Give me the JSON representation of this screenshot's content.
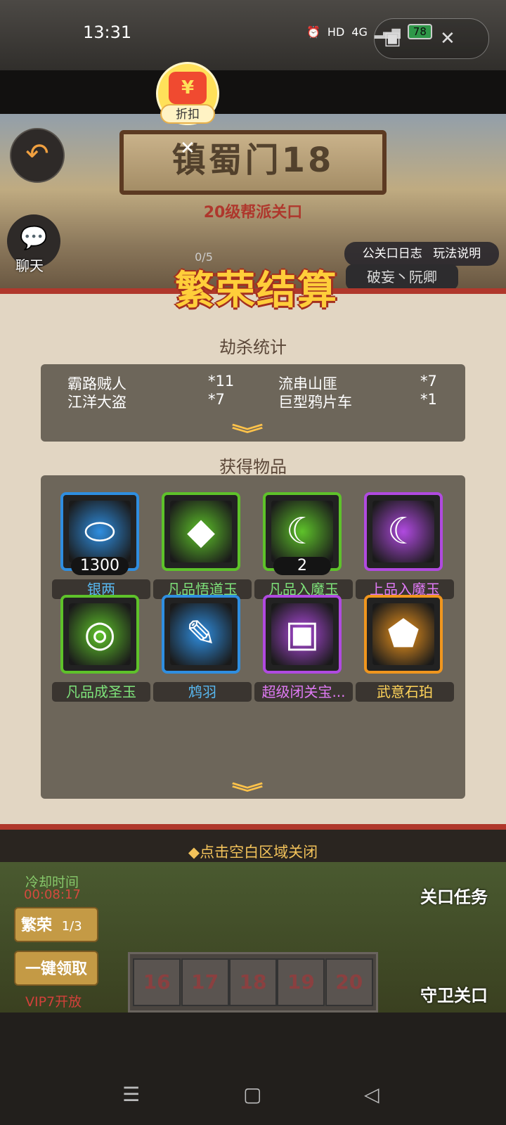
{
  "status_bar": {
    "time": "13:31",
    "battery": "78",
    "network": "4G",
    "hd": "HD"
  },
  "discount": {
    "label": "折扣"
  },
  "stage": {
    "title": "镇蜀门18",
    "subtitle": "20级帮派关口",
    "progress": "0/5"
  },
  "overlay_left": {
    "chat_label": "聊天"
  },
  "overlay_right": {
    "log_label": "公关口日志",
    "help_label": "玩法说明",
    "player_name": "破妄丶阮卿"
  },
  "modal": {
    "title": "繁荣结算",
    "kill_section": "劫杀统计",
    "kills": [
      {
        "name": "霸路贼人",
        "count": "*11"
      },
      {
        "name": "流串山匪",
        "count": "*7"
      },
      {
        "name": "江洋大盗",
        "count": "*7"
      },
      {
        "name": "巨型鸦片车",
        "count": "*1"
      }
    ],
    "items_section": "获得物品",
    "items": [
      {
        "name": "银两",
        "count": "1300",
        "icon": "silver-ingot-icon",
        "rarity_color": "#2f8ee0",
        "name_color": "#58b8f0"
      },
      {
        "name": "凡品悟道玉",
        "count": "",
        "icon": "green-gem-icon",
        "rarity_color": "#5ec22a",
        "name_color": "#7ee27a"
      },
      {
        "name": "凡品入魔玉",
        "count": "2",
        "icon": "green-moon-icon",
        "rarity_color": "#5ec22a",
        "name_color": "#7ee27a"
      },
      {
        "name": "上品入魔玉",
        "count": "",
        "icon": "purple-moon-icon",
        "rarity_color": "#b04ae0",
        "name_color": "#e07af5"
      },
      {
        "name": "凡品成圣玉",
        "count": "",
        "icon": "green-swirl-icon",
        "rarity_color": "#5ec22a",
        "name_color": "#7ee27a"
      },
      {
        "name": "鸩羽",
        "count": "",
        "icon": "feather-icon",
        "rarity_color": "#2f8ee0",
        "name_color": "#58b8f0"
      },
      {
        "name": "超级闭关宝...",
        "count": "",
        "icon": "treasure-chest-icon",
        "rarity_color": "#b04ae0",
        "name_color": "#e07af5"
      },
      {
        "name": "武意石珀",
        "count": "",
        "icon": "amber-crystal-icon",
        "rarity_color": "#f0961e",
        "name_color": "#ffd45a"
      }
    ],
    "close_hint": "◆点击空白区域关闭"
  },
  "bottom": {
    "cooldown_label": "冷却时间",
    "cooldown_time": "00:08:17",
    "prosperity_label": "繁荣",
    "prosperity_count": "1/3",
    "claim_all_label": "一键领取",
    "vip_hint": "VIP7开放",
    "gate_task_label": "关口任务",
    "guard_gate_label": "守卫关口",
    "levels": [
      "16",
      "17",
      "18",
      "19",
      "20"
    ]
  }
}
